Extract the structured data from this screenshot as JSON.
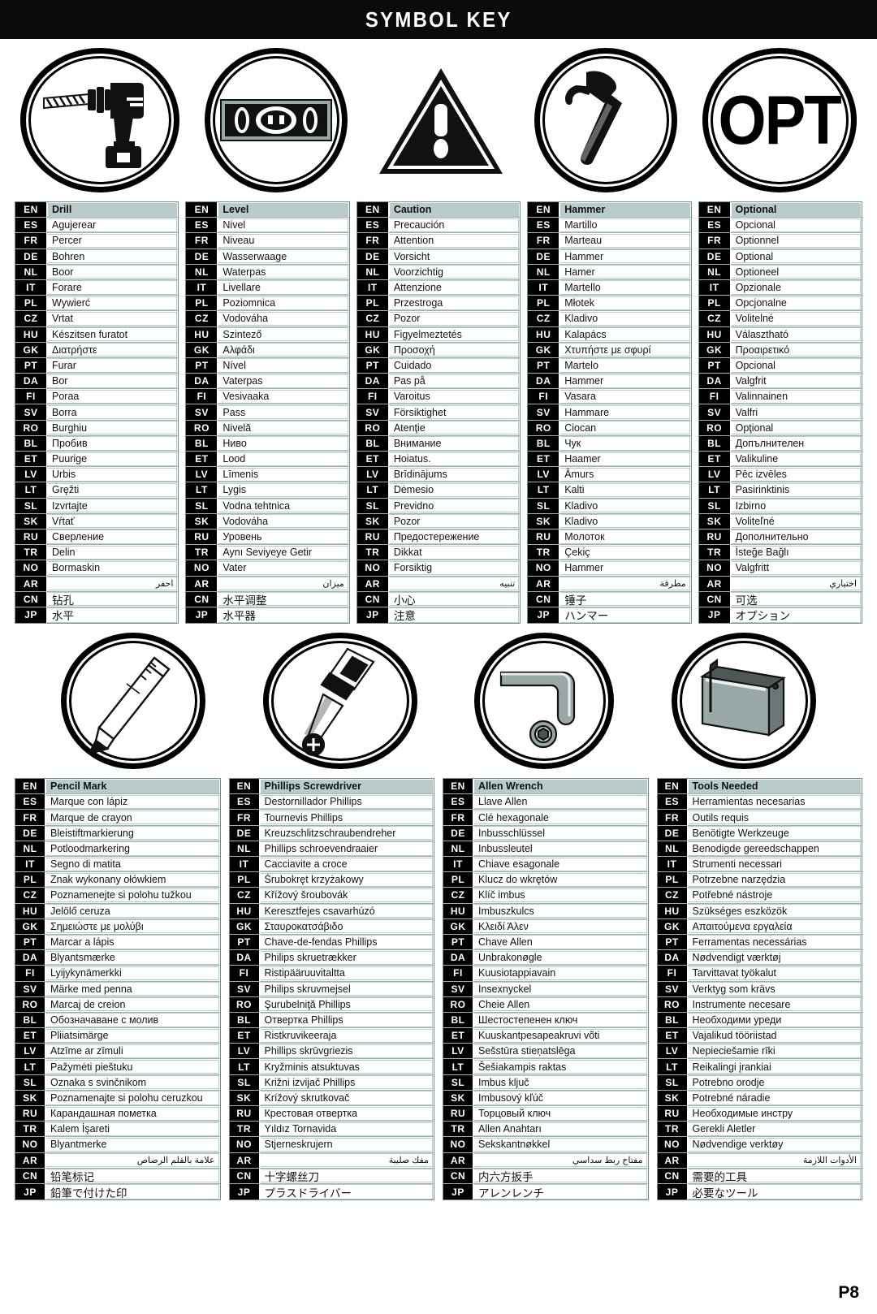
{
  "header": {
    "title": "SYMBOL KEY"
  },
  "page": {
    "number": "P8"
  },
  "icons_row_1": [
    {
      "name": "drill-icon",
      "alt": "Cordless drill"
    },
    {
      "name": "level-icon",
      "alt": "Spirit level"
    },
    {
      "name": "caution-icon",
      "alt": "Warning triangle with exclamation mark"
    },
    {
      "name": "hammer-icon",
      "alt": "Claw hammer"
    },
    {
      "name": "optional-icon",
      "alt": "OPT",
      "text": "OPT"
    }
  ],
  "icons_row_2": [
    {
      "name": "pencil-icon",
      "alt": "Pencil"
    },
    {
      "name": "phillips-screwdriver-icon",
      "alt": "Phillips screwdriver and screw"
    },
    {
      "name": "allen-wrench-icon",
      "alt": "Allen wrench and hex bolt"
    },
    {
      "name": "toolbox-icon",
      "alt": "Tool box"
    }
  ],
  "language_codes": [
    "EN",
    "ES",
    "FR",
    "DE",
    "NL",
    "IT",
    "PL",
    "CZ",
    "HU",
    "GK",
    "PT",
    "DA",
    "FI",
    "SV",
    "RO",
    "BL",
    "ET",
    "LV",
    "LT",
    "SL",
    "SK",
    "RU",
    "TR",
    "NO",
    "AR",
    "CN",
    "JP"
  ],
  "tables_row_1": [
    {
      "id": "drill",
      "terms": [
        "Drill",
        "Agujerear",
        "Percer",
        "Bohren",
        "Boor",
        "Forare",
        "Wywierć",
        "Vrtat",
        "Készitsen furatot",
        "Διατρήστε",
        "Furar",
        "Bor",
        "Poraa",
        "Borra",
        "Burghiu",
        "Пробив",
        "Puurige",
        "Urbis",
        "Gręžti",
        "Izvrtajte",
        "Vŕtať",
        "Сверление",
        "Delin",
        "Bormaskin",
        "احفر",
        "钻孔",
        "水平"
      ]
    },
    {
      "id": "level",
      "terms": [
        "Level",
        "Nivel",
        "Niveau",
        "Wasserwaage",
        "Waterpas",
        "Livellare",
        "Poziomnica",
        "Vodováha",
        "Szintező",
        "Αλφάδι",
        "Nível",
        "Vaterpas",
        "Vesivaaka",
        "Pass",
        "Nivelă",
        "Ниво",
        "Lood",
        "Līmenis",
        "Lygis",
        "Vodna tehtnica",
        "Vodováha",
        "Уровень",
        "Aynı Seviyeye Getir",
        "Vater",
        "ميزان",
        "水平调整",
        "水平器"
      ]
    },
    {
      "id": "caution",
      "terms": [
        "Caution",
        "Precaución",
        "Attention",
        "Vorsicht",
        "Voorzichtig",
        "Attenzione",
        "Przestroga",
        "Pozor",
        "Figyelmeztetés",
        "Προσοχή",
        "Cuidado",
        "Pas på",
        "Varoitus",
        "Försiktighet",
        "Atenţie",
        "Внимание",
        "Hoiatus.",
        "Brīdinājums",
        "Dėmesio",
        "Previdno",
        "Pozor",
        "Предостережение",
        "Dikkat",
        "Forsiktig",
        "تنبيه",
        "小心",
        "注意"
      ]
    },
    {
      "id": "hammer",
      "terms": [
        "Hammer",
        "Martillo",
        "Marteau",
        "Hammer",
        "Hamer",
        "Martello",
        "Młotek",
        "Kladivo",
        "Kalapács",
        "Χτυπήστε με σφυρί",
        "Martelo",
        "Hammer",
        "Vasara",
        "Hammare",
        "Ciocan",
        "Чук",
        "Haamer",
        "Āmurs",
        "Kalti",
        "Kladivo",
        "Kladivo",
        "Молоток",
        "Çekiç",
        "Hammer",
        "مطرقة",
        "锤子",
        "ハンマー"
      ]
    },
    {
      "id": "optional",
      "terms": [
        "Optional",
        "Opcional",
        "Optionnel",
        "Optional",
        "Optioneel",
        "Opzionale",
        "Opcjonalne",
        "Volitelné",
        "Választható",
        "Προαιρετικό",
        "Opcional",
        "Valgfrit",
        "Valinnainen",
        "Valfri",
        "Opţional",
        "Допълнителен",
        "Valikuline",
        "Pēc izvēles",
        "Pasirinktinis",
        "Izbirno",
        "Voliteľné",
        "Дополнительно",
        "İsteğe Bağlı",
        "Valgfritt",
        "اختياري",
        "可选",
        "オプション"
      ]
    }
  ],
  "tables_row_2": [
    {
      "id": "pencil-mark",
      "terms": [
        "Pencil Mark",
        "Marque con lápiz",
        "Marque de crayon",
        "Bleistiftmarkierung",
        "Potloodmarkering",
        "Segno di matita",
        "Znak wykonany ołówkiem",
        "Poznamenejte si polohu tužkou",
        "Jelölő ceruza",
        "Σημειώστε με μολύβι",
        "Marcar a lápis",
        "Blyantsmærke",
        "Lyijykynämerkki",
        "Märke med penna",
        "Marcaj de creion",
        "Обозначаване с молив",
        "Pliiatsimärge",
        "Atzīme ar zīmuli",
        "Pažymėti pieštuku",
        "Oznaka s svinčnikom",
        "Poznamenajte si polohu ceruzkou",
        "Карандашная пометка",
        "Kalem İşareti",
        "Blyantmerke",
        "علامة بالقلم الرصاص",
        "铅笔标记",
        "鉛筆で付けた印"
      ]
    },
    {
      "id": "phillips-screwdriver",
      "terms": [
        "Phillips Screwdriver",
        "Destornillador Phillips",
        "Tournevis Phillips",
        "Kreuzschlitzschraubendreher",
        "Phillips schroevendraaier",
        "Cacciavite a croce",
        "Śrubokręt krzyżakowy",
        "Křížový šroubovák",
        "Keresztfejes csavarhúzó",
        "Σταυροκατσάβιδο",
        "Chave-de-fendas Phillips",
        "Philips skruetrækker",
        "Ristipääruuvitaltta",
        "Philips skruvmejsel",
        "Şurubelniţă Phillips",
        "Отвертка Phillips",
        "Ristkruvikeeraja",
        "Phillips skrūvgriezis",
        "Kryžminis atsuktuvas",
        "Križni izvijač Phillips",
        "Krížový skrutkovač",
        "Крестовая отвертка",
        "Yıldız Tornavida",
        "Stjerneskrujern",
        "مفك صليبة",
        "十字螺丝刀",
        "プラスドライバー"
      ]
    },
    {
      "id": "allen-wrench",
      "terms": [
        "Allen Wrench",
        "Llave Allen",
        "Clé hexagonale",
        "Inbusschlüssel",
        "Inbussleutel",
        "Chiave esagonale",
        "Klucz do wkrętów",
        "Klíč imbus",
        "Imbuszkulcs",
        "Κλειδί Άλεν",
        "Chave Allen",
        "Unbrakonøgle",
        "Kuusiotappiavain",
        "Insexnyckel",
        "Cheie Allen",
        "Шестостепенен ключ",
        "Kuuskantpesapeakruvi võti",
        "Sešstūra stieņatslēga",
        "Šešiakampis raktas",
        "Imbus ključ",
        "Imbusový kľúč",
        "Торцовый ключ",
        "Allen Anahtarı",
        "Sekskantnøkkel",
        "مفتاح ربط سداسي",
        "内六方扳手",
        "アレンレンチ"
      ]
    },
    {
      "id": "tools-needed",
      "terms": [
        "Tools Needed",
        "Herramientas necesarias",
        "Outils requis",
        "Benötigte Werkzeuge",
        "Benodigde gereedschappen",
        "Strumenti necessari",
        "Potrzebne narzędzia",
        "Potřebné nástroje",
        "Szükséges eszközök",
        "Απαιτούμενα εργαλεία",
        "Ferramentas necessárias",
        "Nødvendigt værktøj",
        "Tarvittavat työkalut",
        "Verktyg som krävs",
        "Instrumente necesare",
        "Необходими уреди",
        "Vajalikud tööriistad",
        "Nepieciešamie rīki",
        "Reikalingi įrankiai",
        "Potrebno orodje",
        "Potrebné náradie",
        "Необходимые инстру",
        "Gerekli Aletler",
        "Nødvendige verktøy",
        "الأدوات اللازمة",
        "需要的工具",
        "必要なツール"
      ]
    }
  ],
  "colors": {
    "title_bar": "#0b0b0b",
    "code_cell": "#000000",
    "header_term": "#b9cccb",
    "table_border": "#6d8f8f"
  }
}
